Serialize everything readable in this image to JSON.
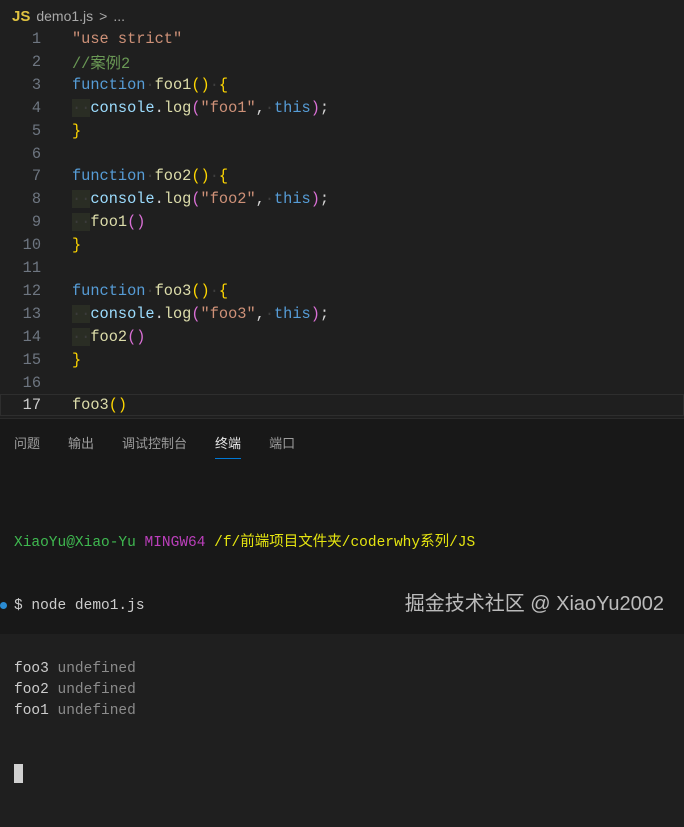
{
  "breadcrumb": {
    "lang_icon": "JS",
    "file": "demo1.js",
    "separator": ">",
    "more": "..."
  },
  "editor": {
    "current_line": 17,
    "lines": [
      {
        "n": "1",
        "t": [
          [
            "\"use strict\"",
            "str"
          ]
        ]
      },
      {
        "n": "2",
        "t": [
          [
            "//案例2",
            "cm"
          ]
        ]
      },
      {
        "n": "3",
        "t": [
          [
            "function",
            "kw"
          ],
          [
            "·",
            "ws"
          ],
          [
            "foo1",
            "fn"
          ],
          [
            "()",
            "b1"
          ],
          [
            "·",
            "ws"
          ],
          [
            "{",
            "b1"
          ]
        ]
      },
      {
        "n": "4",
        "t": [
          [
            "··",
            "ind"
          ],
          [
            "console",
            "var"
          ],
          [
            ".",
            "pl"
          ],
          [
            "log",
            "fn"
          ],
          [
            "(",
            "b2"
          ],
          [
            "\"foo1\"",
            "str"
          ],
          [
            ",",
            "pl"
          ],
          [
            "·",
            "ws"
          ],
          [
            "this",
            "kw"
          ],
          [
            ")",
            "b2"
          ],
          [
            ";",
            "pl"
          ]
        ]
      },
      {
        "n": "5",
        "t": [
          [
            "}",
            "b1"
          ]
        ]
      },
      {
        "n": "6",
        "t": []
      },
      {
        "n": "7",
        "t": [
          [
            "function",
            "kw"
          ],
          [
            "·",
            "ws"
          ],
          [
            "foo2",
            "fn"
          ],
          [
            "()",
            "b1"
          ],
          [
            "·",
            "ws"
          ],
          [
            "{",
            "b1"
          ]
        ]
      },
      {
        "n": "8",
        "t": [
          [
            "··",
            "ind"
          ],
          [
            "console",
            "var"
          ],
          [
            ".",
            "pl"
          ],
          [
            "log",
            "fn"
          ],
          [
            "(",
            "b2"
          ],
          [
            "\"foo2\"",
            "str"
          ],
          [
            ",",
            "pl"
          ],
          [
            "·",
            "ws"
          ],
          [
            "this",
            "kw"
          ],
          [
            ")",
            "b2"
          ],
          [
            ";",
            "pl"
          ]
        ]
      },
      {
        "n": "9",
        "t": [
          [
            "··",
            "ind"
          ],
          [
            "foo1",
            "fn"
          ],
          [
            "()",
            "b2"
          ]
        ]
      },
      {
        "n": "10",
        "t": [
          [
            "}",
            "b1"
          ]
        ]
      },
      {
        "n": "11",
        "t": []
      },
      {
        "n": "12",
        "t": [
          [
            "function",
            "kw"
          ],
          [
            "·",
            "ws"
          ],
          [
            "foo3",
            "fn"
          ],
          [
            "()",
            "b1"
          ],
          [
            "·",
            "ws"
          ],
          [
            "{",
            "b1"
          ]
        ]
      },
      {
        "n": "13",
        "t": [
          [
            "··",
            "ind"
          ],
          [
            "console",
            "var"
          ],
          [
            ".",
            "pl"
          ],
          [
            "log",
            "fn"
          ],
          [
            "(",
            "b2"
          ],
          [
            "\"foo3\"",
            "str"
          ],
          [
            ",",
            "pl"
          ],
          [
            "·",
            "ws"
          ],
          [
            "this",
            "kw"
          ],
          [
            ")",
            "b2"
          ],
          [
            ";",
            "pl"
          ]
        ]
      },
      {
        "n": "14",
        "t": [
          [
            "··",
            "ind"
          ],
          [
            "foo2",
            "fn"
          ],
          [
            "()",
            "b2"
          ]
        ]
      },
      {
        "n": "15",
        "t": [
          [
            "}",
            "b1"
          ]
        ]
      },
      {
        "n": "16",
        "t": []
      },
      {
        "n": "17",
        "t": [
          [
            "foo3",
            "fn"
          ],
          [
            "()",
            "b1"
          ]
        ]
      }
    ]
  },
  "panel": {
    "tabs": [
      "问题",
      "输出",
      "调试控制台",
      "终端",
      "端口"
    ],
    "active_tab": "终端"
  },
  "terminal": {
    "user": "XiaoYu@Xiao-Yu",
    "env": "MINGW64",
    "path": "/f/前端项目文件夹/coderwhy系列/JS",
    "command": "$ node demo1.js",
    "output": [
      [
        "foo3",
        "undefined"
      ],
      [
        "foo2",
        "undefined"
      ],
      [
        "foo1",
        "undefined"
      ]
    ]
  },
  "watermark": "掘金技术社区 @ XiaoYu2002"
}
